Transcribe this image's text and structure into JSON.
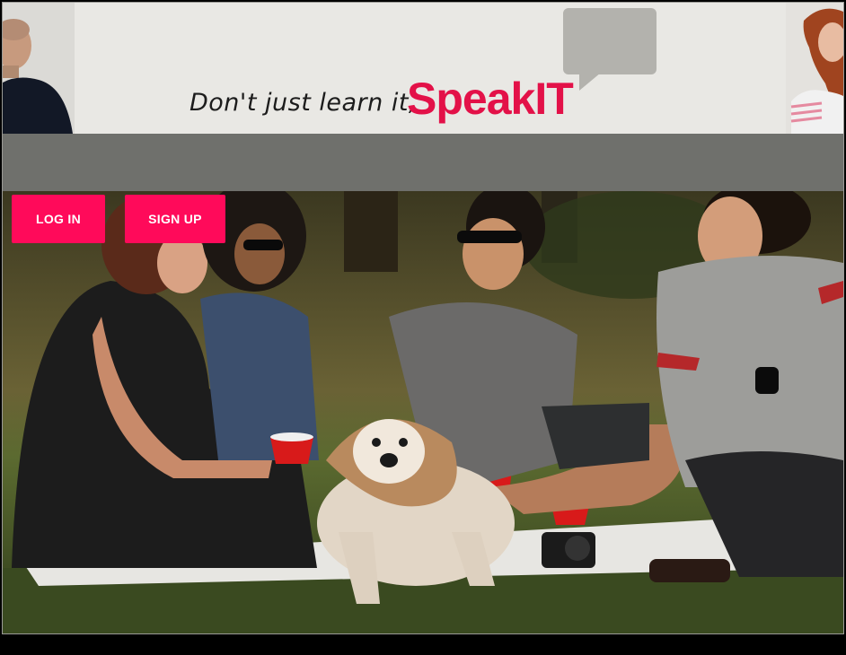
{
  "banner": {
    "tagline": "Don't just learn it,",
    "brand": "SpeakIT"
  },
  "nav": {
    "login_label": "LOG IN",
    "signup_label": "SIGN UP"
  },
  "colors": {
    "brand": "#e31148",
    "button": "#ff0a5a",
    "navbar": "#6f706c",
    "banner_bg": "#e9e8e4"
  },
  "hero": {
    "image": "friends-picnic-with-dog"
  }
}
